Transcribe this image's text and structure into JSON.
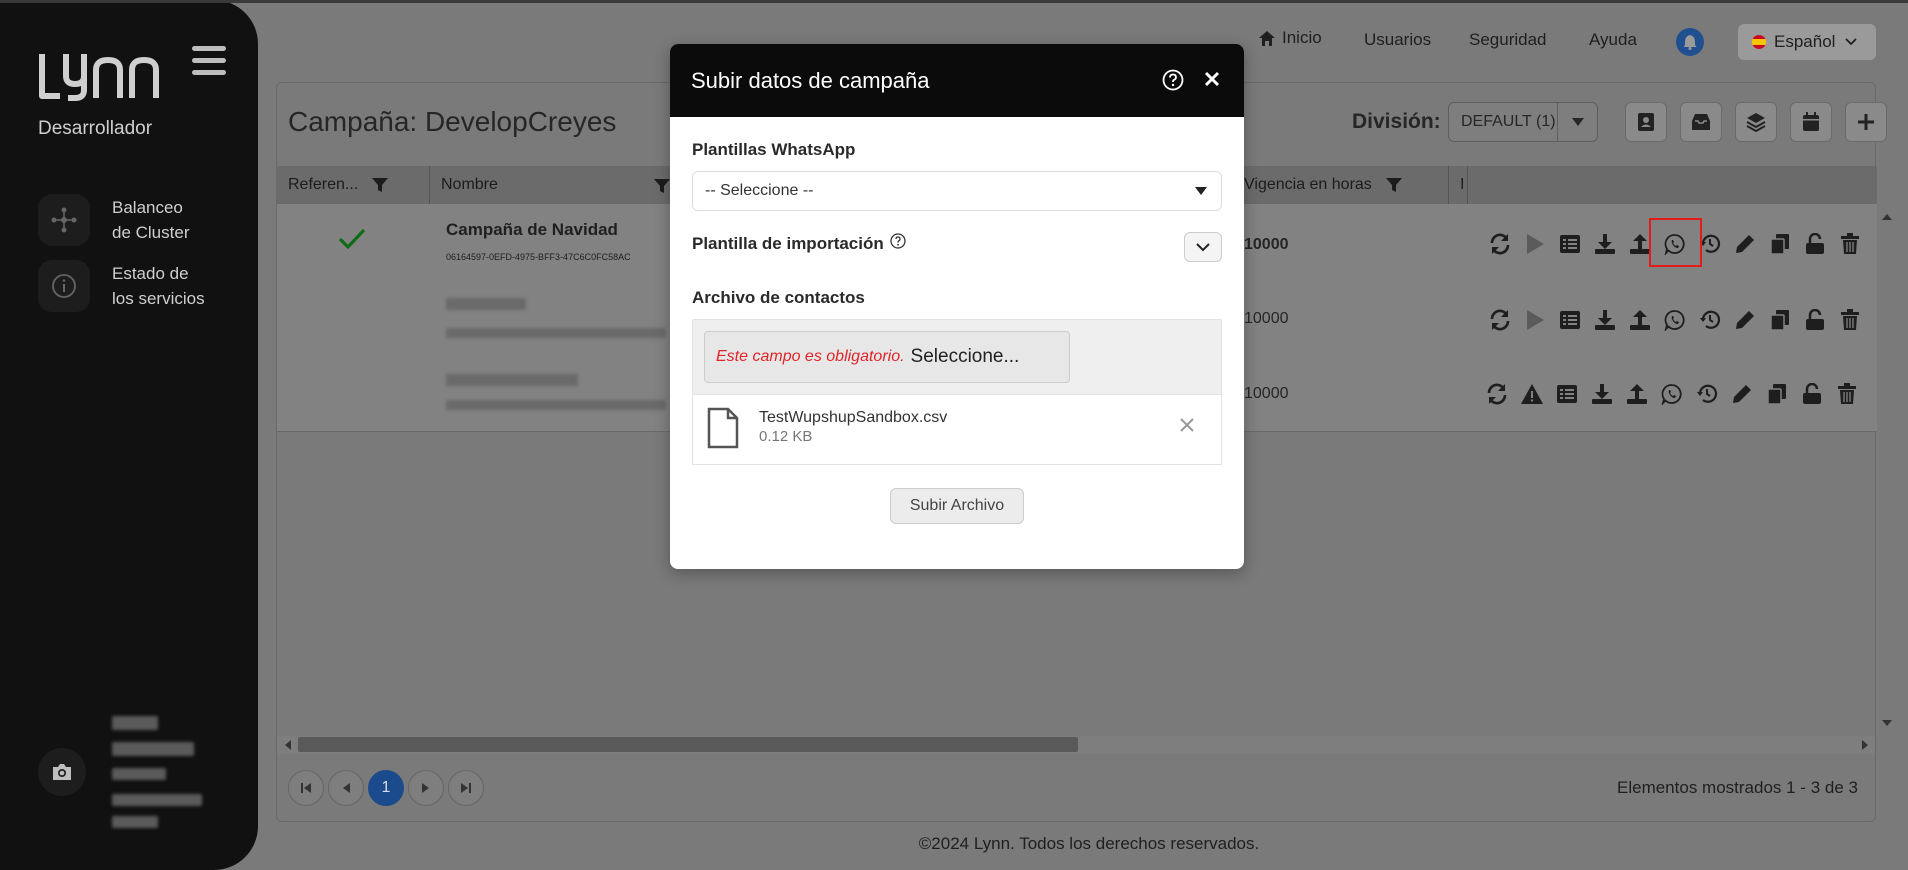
{
  "sidebar": {
    "role": "Desarrollador",
    "items": [
      {
        "label_line1": "Balanceo",
        "label_line2": "de Cluster"
      },
      {
        "label_line1": "Estado de",
        "label_line2": "los servicios"
      }
    ]
  },
  "header": {
    "nav": {
      "home": "Inicio",
      "users": "Usuarios",
      "security": "Seguridad",
      "help": "Ayuda"
    },
    "language": "Español"
  },
  "page": {
    "title": "Campaña: DevelopCreyes",
    "division_label": "División:",
    "division_value": "DEFAULT (1)"
  },
  "table": {
    "columns": [
      "Referen...",
      "Nombre",
      "Vigencia en horas",
      "I"
    ],
    "first_row": {
      "name": "Campaña de Navidad",
      "id": "06164597-0EFD-4975-BFF3-47C6C0FC58AC",
      "vigencia": "10000"
    },
    "vigencias": [
      "10000",
      "10000",
      "10000"
    ]
  },
  "pagination": {
    "current_page": "1",
    "shown": "Elementos mostrados 1 - 3 de 3"
  },
  "footer": "©2024 Lynn. Todos los derechos reservados.",
  "modal": {
    "title": "Subir datos de campaña",
    "whatsapp_label": "Plantillas WhatsApp",
    "whatsapp_select": "-- Seleccione --",
    "import_label": "Plantilla de importación",
    "contacts_label": "Archivo de contactos",
    "required_msg": "Este campo es obligatorio.",
    "choose_label": "Seleccione...",
    "file_name": "TestWupshupSandbox.csv",
    "file_size": "0.12 KB",
    "upload_label": "Subir Archivo"
  },
  "colors": {
    "highlight": "#e31b1b",
    "accent": "#1b4b8c",
    "required": "#e0252a"
  }
}
